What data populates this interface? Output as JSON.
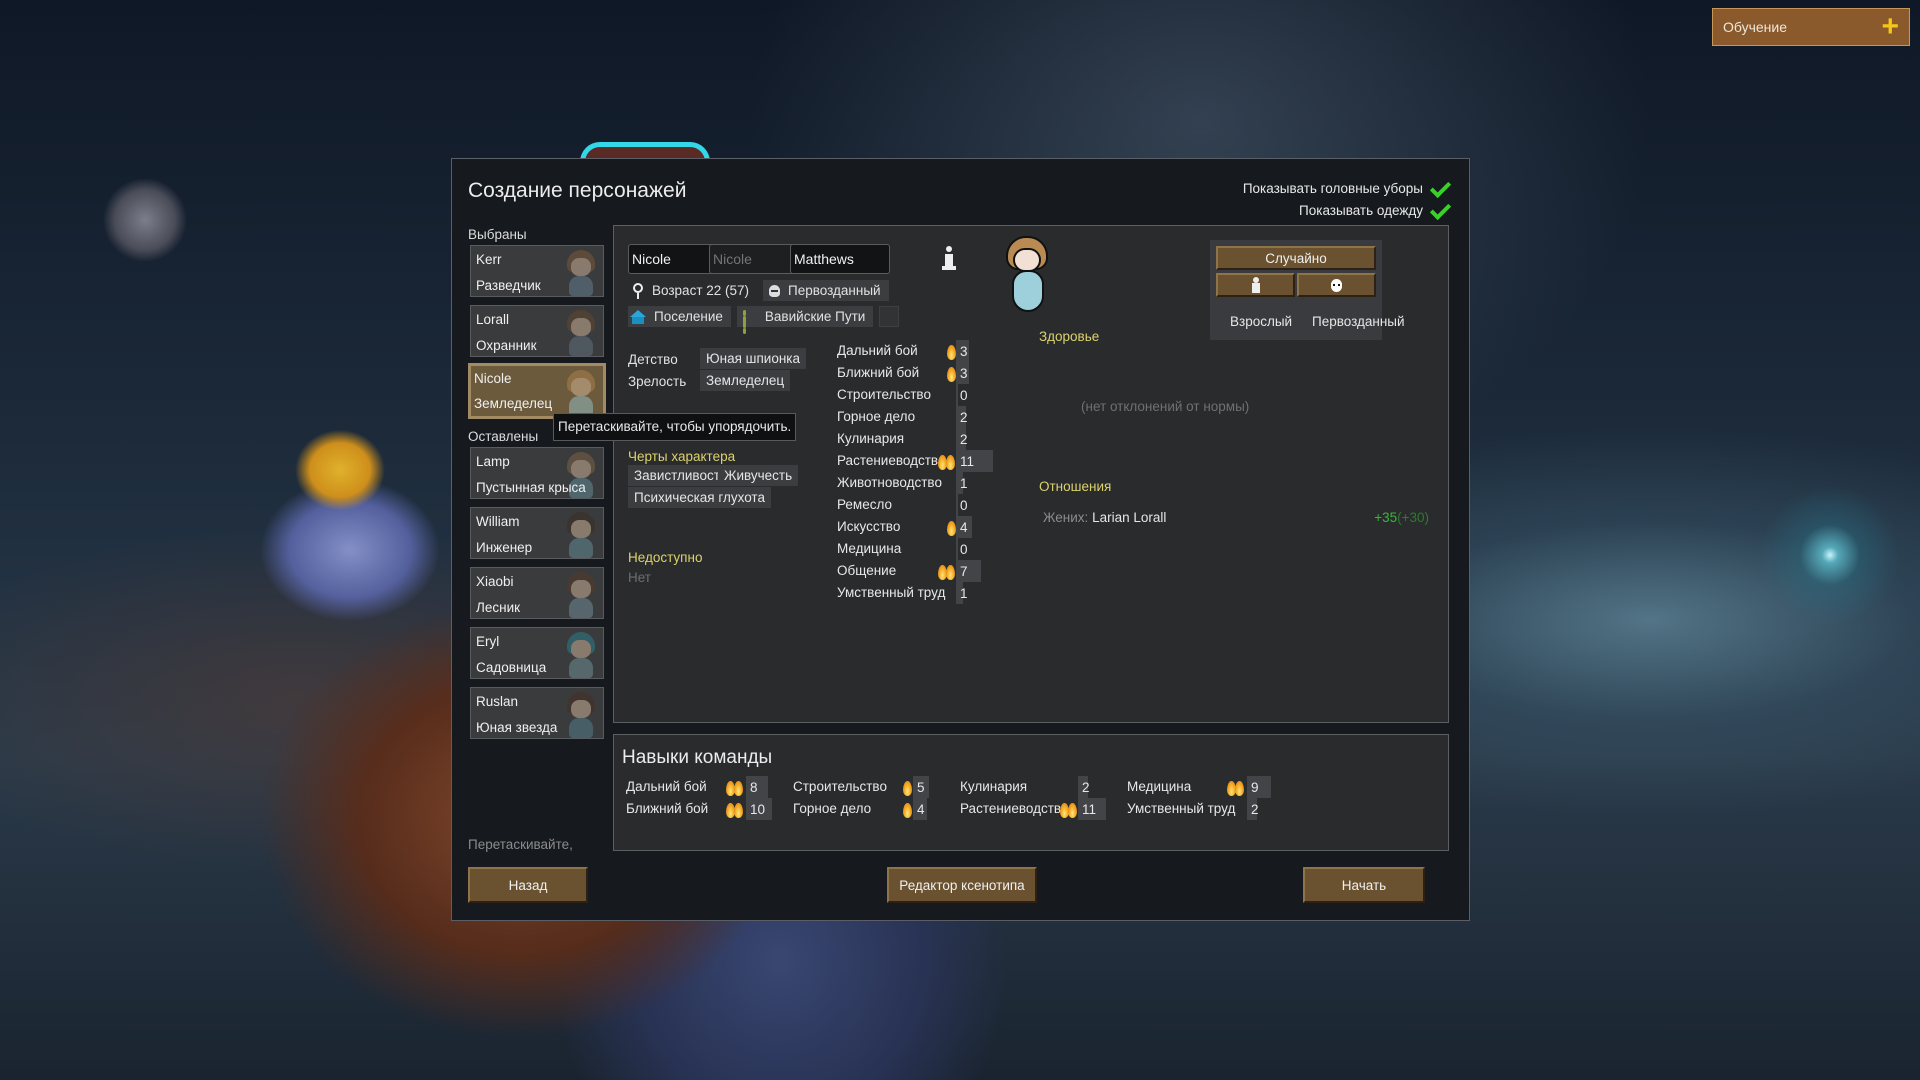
{
  "tutorial": {
    "label": "Обучение",
    "icon": "plus-icon"
  },
  "dialog": {
    "title": "Создание персонажей",
    "toggles": [
      {
        "label": "Показывать головные уборы",
        "checked": true
      },
      {
        "label": "Показывать одежду",
        "checked": true
      }
    ],
    "selected_label": "Выбраны",
    "left_behind_label": "Оставлены",
    "drag_hint": "Перетаскивайте,",
    "tooltip": "Перетаскивайте, чтобы упорядочить.",
    "selected_pawns": [
      {
        "name": "Kerr",
        "title": "Разведчик",
        "hair": "#8a5e3a",
        "body": "#6a8aa0"
      },
      {
        "name": "Lorall",
        "title": "Охранник",
        "hair": "#6a4a2a",
        "body": "#6a7a8a"
      },
      {
        "name": "Nicole",
        "title": "Земледелец",
        "hair": "#b98a52",
        "body": "#9ed0dc",
        "active": true
      }
    ],
    "left_pawns": [
      {
        "name": "Lamp",
        "title": "Пустынная крыса",
        "hair": "#8a6a44",
        "body": "#6a9aa8"
      },
      {
        "name": "William",
        "title": "Инженер",
        "hair": "#3a2a1e",
        "body": "#6a9aa8"
      },
      {
        "name": "Xiaobi",
        "title": "Лесник",
        "hair": "#5a3a24",
        "body": "#7a9aa8"
      },
      {
        "name": "Eryl",
        "title": "Садовница",
        "hair": "#2a8a9a",
        "body": "#7aa0a8"
      },
      {
        "name": "Ruslan",
        "title": "Юная звезда",
        "hair": "#4a2a1a",
        "body": "#5a8a9a"
      }
    ]
  },
  "pawn": {
    "first_name": "Nicole",
    "nickname_placeholder": "Nicole",
    "last_name": "Matthews",
    "age": "Возраст 22 (57)",
    "xenotype": "Первозданный",
    "faction": "Поселение",
    "ideology": "Вавийские Пути",
    "childhood_label": "Детство",
    "childhood": "Юная шпионка",
    "adulthood_label": "Зрелость",
    "adulthood": "Земледелец",
    "traits_label": "Черты характера",
    "traits": [
      "Завистливость",
      "Живучесть",
      "Психическая глухота"
    ],
    "incapable_label": "Недоступно",
    "incapable": "Нет",
    "skills": [
      {
        "name": "Дальний бой",
        "value": 3,
        "passion": 1
      },
      {
        "name": "Ближний бой",
        "value": 3,
        "passion": 1
      },
      {
        "name": "Строительство",
        "value": 0,
        "passion": 0
      },
      {
        "name": "Горное дело",
        "value": 2,
        "passion": 0
      },
      {
        "name": "Кулинария",
        "value": 2,
        "passion": 0
      },
      {
        "name": "Растениеводство",
        "value": 11,
        "passion": 2
      },
      {
        "name": "Животноводство",
        "value": 1,
        "passion": 0
      },
      {
        "name": "Ремесло",
        "value": 0,
        "passion": 0
      },
      {
        "name": "Искусство",
        "value": 4,
        "passion": 1
      },
      {
        "name": "Медицина",
        "value": 0,
        "passion": 0
      },
      {
        "name": "Общение",
        "value": 7,
        "passion": 2
      },
      {
        "name": "Умственный труд",
        "value": 1,
        "passion": 0
      }
    ],
    "health_label": "Здоровье",
    "health_status": "(нет отклонений от нормы)",
    "relations_label": "Отношения",
    "relations": [
      {
        "type": "Жених:",
        "name": "Larian Lorall",
        "score": "+35",
        "score_base": "(+30)"
      }
    ]
  },
  "randomize": {
    "random_label": "Случайно",
    "adult_label": "Взрослый",
    "xeno_label": "Первозданный"
  },
  "team": {
    "title": "Навыки команды",
    "skills": [
      {
        "name": "Дальний бой",
        "value": 8,
        "passion": 2
      },
      {
        "name": "Ближний бой",
        "value": 10,
        "passion": 2
      },
      {
        "name": "Строительство",
        "value": 5,
        "passion": 1
      },
      {
        "name": "Горное дело",
        "value": 4,
        "passion": 1
      },
      {
        "name": "Кулинария",
        "value": 2,
        "passion": 0
      },
      {
        "name": "Растениеводство",
        "value": 11,
        "passion": 2
      },
      {
        "name": "Медицина",
        "value": 9,
        "passion": 2
      },
      {
        "name": "Умственный труд",
        "value": 2,
        "passion": 0
      }
    ]
  },
  "buttons": {
    "back": "Назад",
    "xenotype_editor": "Редактор ксенотипа",
    "start": "Начать"
  }
}
